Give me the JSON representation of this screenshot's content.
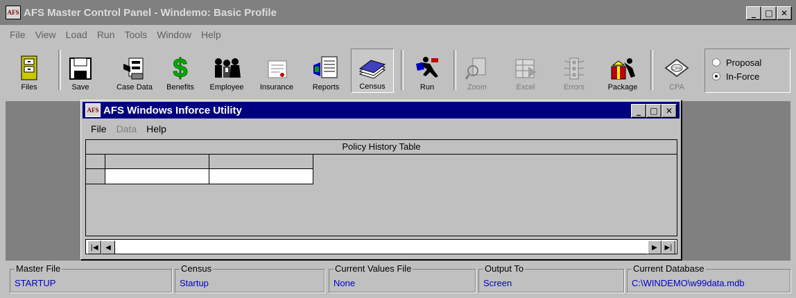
{
  "app": {
    "title": "AFS Master Control Panel - Windemo: Basic Profile",
    "logo_text": "AFS"
  },
  "menu": [
    "File",
    "View",
    "Load",
    "Run",
    "Tools",
    "Window",
    "Help"
  ],
  "toolbar": {
    "files": "Files",
    "save": "Save",
    "case_data": "Case Data",
    "benefits": "Benefits",
    "employee": "Employee",
    "insurance": "Insurance",
    "reports": "Reports",
    "census": "Census",
    "run": "Run",
    "zoom": "Zoom",
    "excel": "Excel",
    "errors": "Errors",
    "package": "Package",
    "cpa": "CPA"
  },
  "mode": {
    "options": [
      "Proposal",
      "In-Force"
    ],
    "selected": "In-Force"
  },
  "child_window": {
    "title": "AFS Windows Inforce Utility",
    "logo_text": "AFS",
    "menu": [
      "File",
      "Data",
      "Help"
    ],
    "grid_title": "Policy History Table"
  },
  "status": {
    "master_file": {
      "label": "Master File",
      "value": "STARTUP"
    },
    "census": {
      "label": "Census",
      "value": "Startup"
    },
    "current_values": {
      "label": "Current Values File",
      "value": "None"
    },
    "output_to": {
      "label": "Output To",
      "value": "Screen"
    },
    "current_database": {
      "label": "Current Database",
      "value": "C:\\WINDEMO\\w99data.mdb"
    }
  },
  "colors": {
    "face": "#c0c0c0",
    "mdi_background": "#808080",
    "active_title": "#000080",
    "status_value": "#0000c8"
  }
}
